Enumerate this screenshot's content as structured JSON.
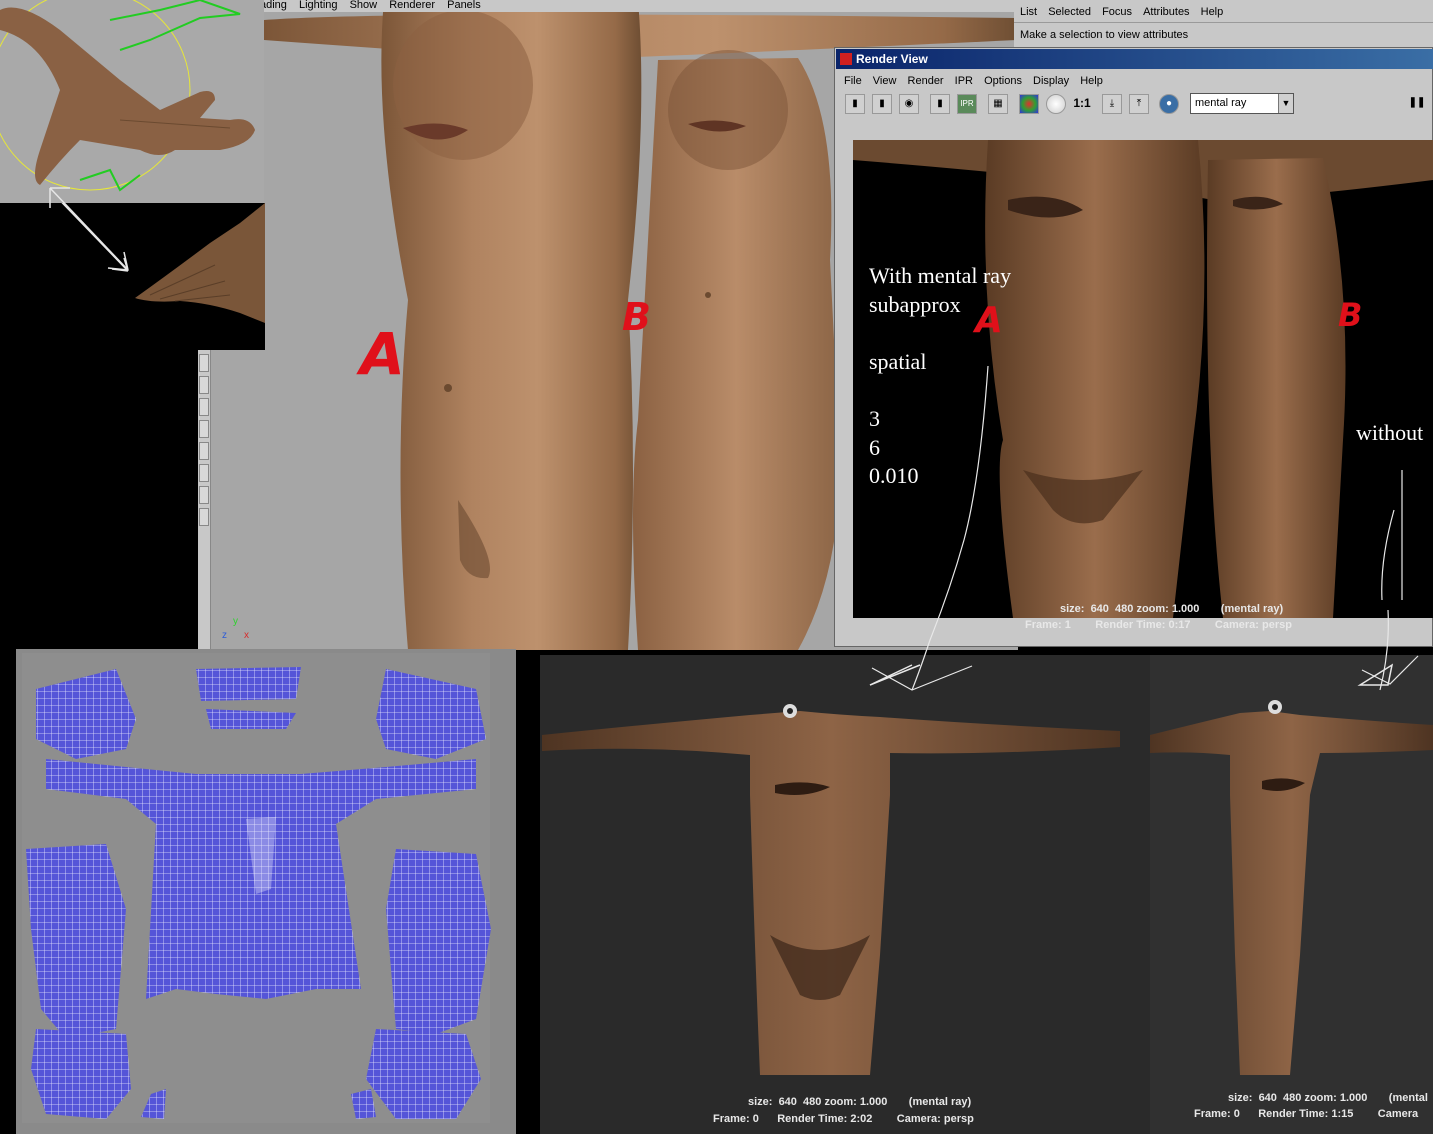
{
  "viewport": {
    "menu": [
      "ading",
      "Lighting",
      "Show",
      "Renderer",
      "Panels"
    ],
    "axis": {
      "y": "y",
      "z": "z",
      "x": "x"
    },
    "mark_a": "A",
    "mark_b": "B"
  },
  "attribute_editor": {
    "menu": [
      "List",
      "Selected",
      "Focus",
      "Attributes",
      "Help"
    ],
    "hint": "Make a selection to view attributes"
  },
  "render_view": {
    "title": "Render View",
    "menu": [
      "File",
      "View",
      "Render",
      "IPR",
      "Options",
      "Display",
      "Help"
    ],
    "toolbar_ratio": "1:1",
    "renderer": "mental ray",
    "size_line": "size:  640  480 zoom: 1.000       (mental ray)",
    "frame_line": "Frame: 1        Render Time: 0:17        Camera: persp",
    "mark_a": "A",
    "mark_b": "B"
  },
  "annotation": {
    "lines": [
      "With mental ray",
      "subapprox",
      "",
      "spatial",
      "",
      "3",
      "6",
      "0.010"
    ],
    "without": "without"
  },
  "bottom_render_left": {
    "size_line": "size:  640  480 zoom: 1.000       (mental ray)",
    "frame_line": "Frame: 0      Render Time: 2:02        Camera: persp"
  },
  "bottom_render_right": {
    "size_line": "size:  640  480 zoom: 1.000       (mental",
    "frame_line": "Frame: 0      Render Time: 1:15        Camera"
  },
  "colors": {
    "viewport_bg": "#a6a6a6",
    "ui_gray": "#c8c8c8",
    "title_bar": "#0a246a",
    "uv_wire": "#3a3ad0",
    "red_mark": "#e0101a"
  },
  "icons": [
    "render-frame-icon",
    "rerender-icon",
    "snapshot-icon",
    "ipr-icon",
    "region-icon",
    "color-icon",
    "sphere-icon",
    "keep-image-icon",
    "remove-image-icon",
    "camera-icon",
    "pause-icon"
  ]
}
